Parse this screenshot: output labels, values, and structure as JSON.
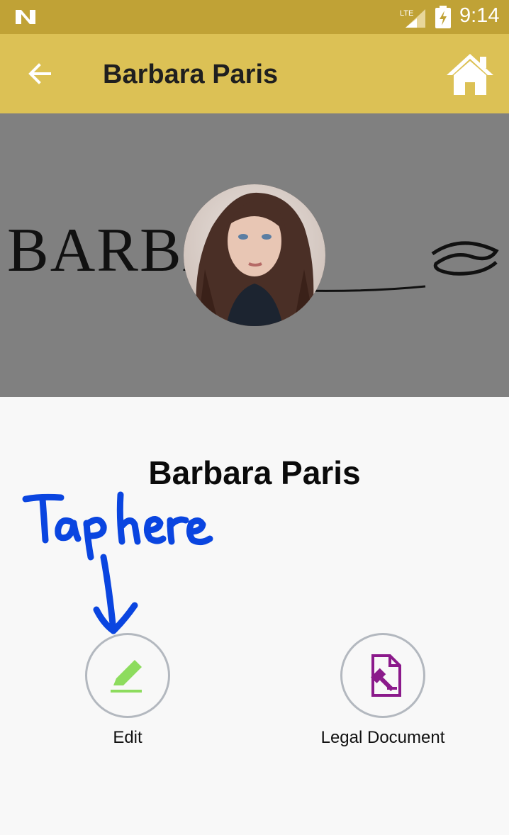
{
  "status_bar": {
    "time": "9:14",
    "network_label": "LTE",
    "icons": [
      "n-notification-icon",
      "lte-signal-icon",
      "battery-charging-icon"
    ]
  },
  "app_bar": {
    "title": "Barbara Paris",
    "back_icon": "arrow-left-icon",
    "home_icon": "home-icon",
    "background_color": "#dcc155"
  },
  "banner": {
    "brand_logo_text": "BARBARA",
    "background_color": "#808080"
  },
  "profile": {
    "name": "Barbara Paris"
  },
  "annotation": {
    "text": "Tap here",
    "color": "#0a45e0"
  },
  "actions": [
    {
      "label": "Edit",
      "icon": "pencil-icon",
      "icon_color": "#8ddc5e"
    },
    {
      "label": "Legal Document",
      "icon": "legal-document-icon",
      "icon_color": "#8b1a8b"
    }
  ]
}
